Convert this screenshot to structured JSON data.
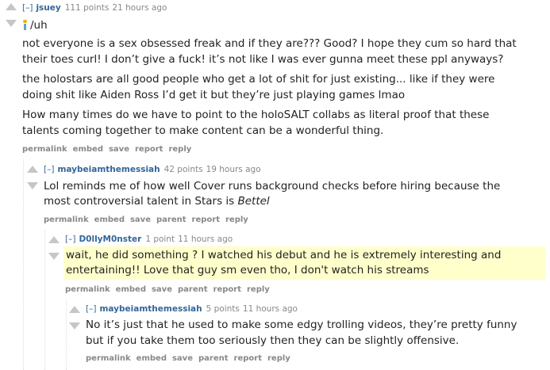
{
  "comments": [
    {
      "expand": "[–]",
      "author": "jsuey",
      "score": "111 points",
      "time": "21 hours ago",
      "flair": "/uh",
      "paragraphs": [
        [
          "not everyone is a sex obsessed freak and if they are??? Good? I hope they cum so hard that",
          "their toes curl! I don’t give a fuck! it’s not like I was ever gunna meet these ppl anyways?"
        ],
        [
          "the holostars are all good people who get a lot of shit for just existing... like if they were",
          "doing shit like Aiden Ross I’d get it but they’re just playing games lmao"
        ],
        [
          "How many times do we have to point to the holoSALT collabs as literal proof that these",
          "talents coming together to make content can be a wonderful thing."
        ]
      ],
      "buttons": [
        "permalink",
        "embed",
        "save",
        "report",
        "reply"
      ]
    },
    {
      "expand": "[–]",
      "author": "maybeiamthemessiah",
      "score": "42 points",
      "time": "19 hours ago",
      "lines": [
        "Lol reminds me of how well Cover runs background checks before hiring because the",
        "most controversial talent in Stars is "
      ],
      "emphasis": "Bettel",
      "buttons": [
        "permalink",
        "embed",
        "save",
        "parent",
        "report",
        "reply"
      ]
    },
    {
      "expand": "[–]",
      "author": "D0llyM0nster",
      "score": "1 point",
      "time": "11 hours ago",
      "lines": [
        "wait, he did something ? I watched his debut and he is extremely interesting and",
        "entertaining!! Love that guy sm even tho, I don't watch his streams"
      ],
      "buttons": [
        "permalink",
        "embed",
        "save",
        "parent",
        "report",
        "reply"
      ]
    },
    {
      "expand": "[–]",
      "author": "maybeiamthemessiah",
      "score": "5 points",
      "time": "11 hours ago",
      "lines": [
        "No it’s just that he used to make some edgy trolling videos, they’re pretty funny",
        "but if you take them too seriously then they can be slightly offensive."
      ],
      "buttons": [
        "permalink",
        "embed",
        "save",
        "parent",
        "report",
        "reply"
      ]
    }
  ]
}
